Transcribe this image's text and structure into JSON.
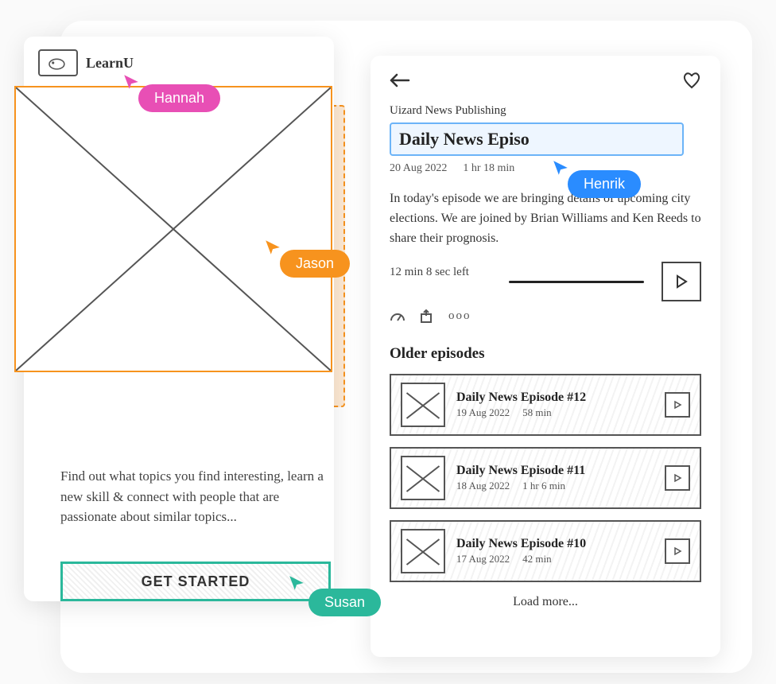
{
  "left": {
    "logo_text": "LearnU",
    "description": "Find out what topics you find interesting, learn a new skill & connect with people that are passionate about similar topics...",
    "cta_label": "GET STARTED"
  },
  "right": {
    "publisher": "Uizard News Publishing",
    "title_value": "Daily News Episo",
    "date": "20 Aug 2022",
    "duration": "1 hr 18 min",
    "summary": "In today's episode we are bringing details of upcoming city elections. We are joined by Brian Williams and Ken Reeds to share their prognosis.",
    "time_left": "12 min 8 sec left",
    "more_symbol": "ooo",
    "older_heading": "Older episodes",
    "load_more": "Load more...",
    "episodes": [
      {
        "title": "Daily News Episode #12",
        "date": "19 Aug 2022",
        "duration": "58 min"
      },
      {
        "title": "Daily News Episode #11",
        "date": "18 Aug 2022",
        "duration": "1 hr 6 min"
      },
      {
        "title": "Daily News Episode #10",
        "date": "17 Aug 2022",
        "duration": "42 min"
      }
    ]
  },
  "cursors": {
    "hannah": "Hannah",
    "jason": "Jason",
    "susan": "Susan",
    "henrik": "Henrik"
  },
  "colors": {
    "hannah": "#e84fb5",
    "jason": "#f7931e",
    "susan": "#2bb89b",
    "henrik": "#2a8cff"
  }
}
